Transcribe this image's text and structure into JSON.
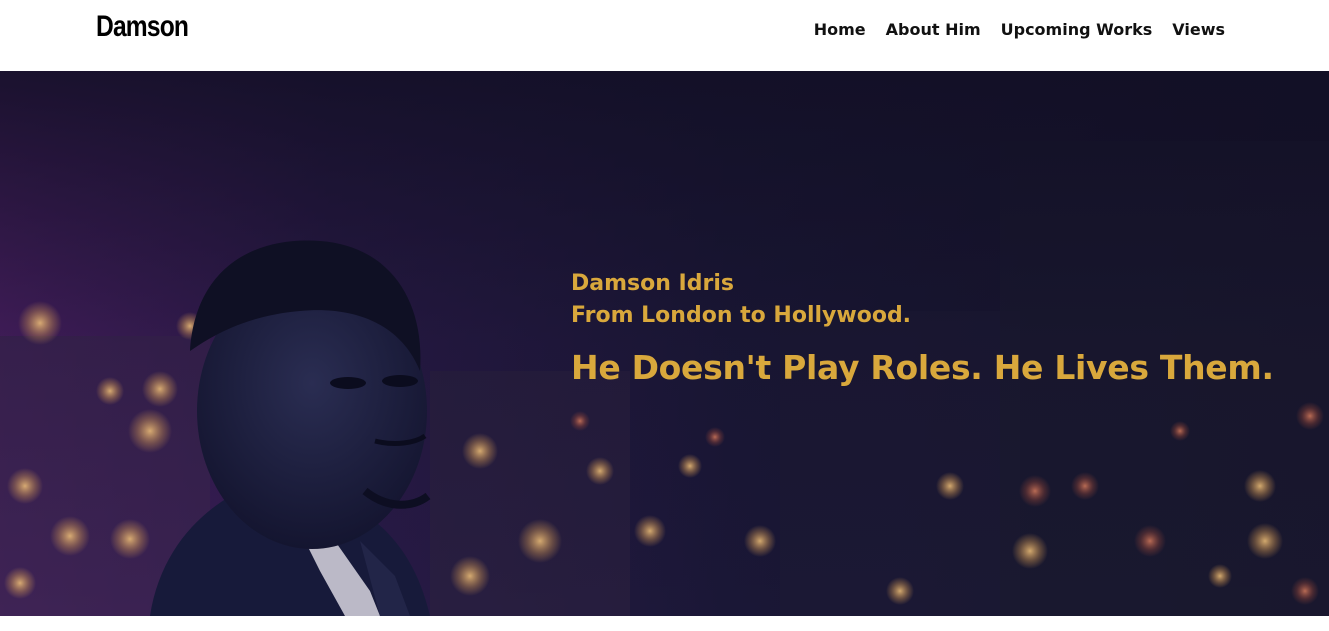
{
  "header": {
    "logo": "Damson",
    "nav": [
      {
        "label": "Home"
      },
      {
        "label": "About Him"
      },
      {
        "label": "Upcoming Works"
      },
      {
        "label": "Views"
      }
    ]
  },
  "hero": {
    "name": "Damson Idris",
    "subtitle": "From London to Hollywood.",
    "tagline": "He Doesn't Play Roles. He Lives Them.",
    "text_color": "#d9a83c",
    "background_color": "#171430",
    "image": "portrait-night-city"
  }
}
